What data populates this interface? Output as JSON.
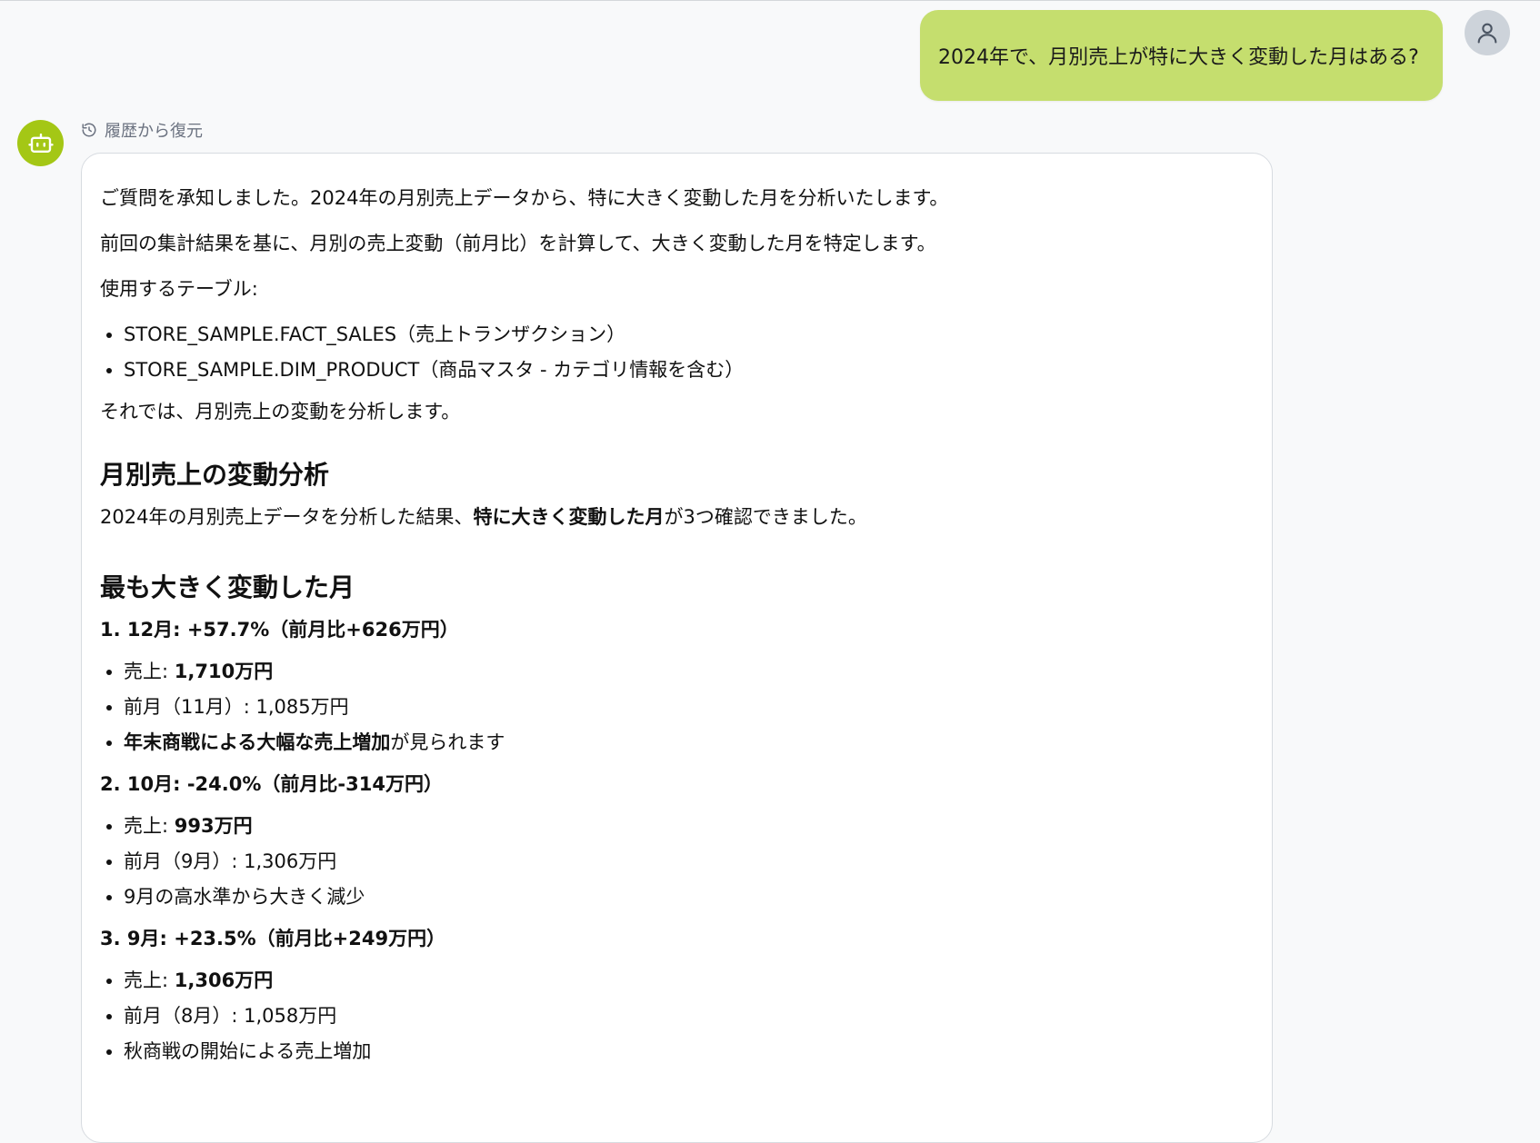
{
  "user_message": {
    "text": "2024年で、月別売上が特に大きく変動した月はある?"
  },
  "assistant": {
    "restore_label": "履歴から復元",
    "intro_1": "ご質問を承知しました。2024年の月別売上データから、特に大きく変動した月を分析いたします。",
    "intro_2": "前回の集計結果を基に、月別の売上変動（前月比）を計算して、大きく変動した月を特定します。",
    "tables_heading": "使用するテーブル:",
    "tables": [
      "STORE_SAMPLE.FACT_SALES（売上トランザクション）",
      "STORE_SAMPLE.DIM_PRODUCT（商品マスタ - カテゴリ情報を含む）"
    ],
    "lead_out": "それでは、月別売上の変動を分析します。",
    "section_title": "月別売上の変動分析",
    "summary": {
      "prefix": "2024年の月別売上データを分析した結果、",
      "bold": "特に大きく変動した月",
      "suffix": "が3つ確認できました。"
    },
    "top_title": "最も大きく変動した月",
    "months": [
      {
        "heading": "1. 12月: +57.7%（前月比+626万円）",
        "sales_label": "売上: ",
        "sales_value": "1,710万円",
        "prev": "前月（11月）: 1,085万円",
        "note_bold": "年末商戦による大幅な売上増加",
        "note_rest": "が見られます"
      },
      {
        "heading": "2. 10月: -24.0%（前月比-314万円）",
        "sales_label": "売上: ",
        "sales_value": "993万円",
        "prev": "前月（9月）: 1,306万円",
        "note_bold": "",
        "note_rest": "9月の高水準から大きく減少"
      },
      {
        "heading": "3. 9月: +23.5%（前月比+249万円）",
        "sales_label": "売上: ",
        "sales_value": "1,306万円",
        "prev": "前月（8月）: 1,058万円",
        "note_bold": "",
        "note_rest": "秋商戦の開始による売上増加"
      }
    ]
  },
  "icons": {
    "user_avatar": "user-icon",
    "bot_avatar": "robot-icon",
    "restore": "history-icon"
  },
  "colors": {
    "user_bubble": "#c5de6e",
    "bot_avatar": "#a4c715",
    "user_avatar": "#cdd3da"
  }
}
